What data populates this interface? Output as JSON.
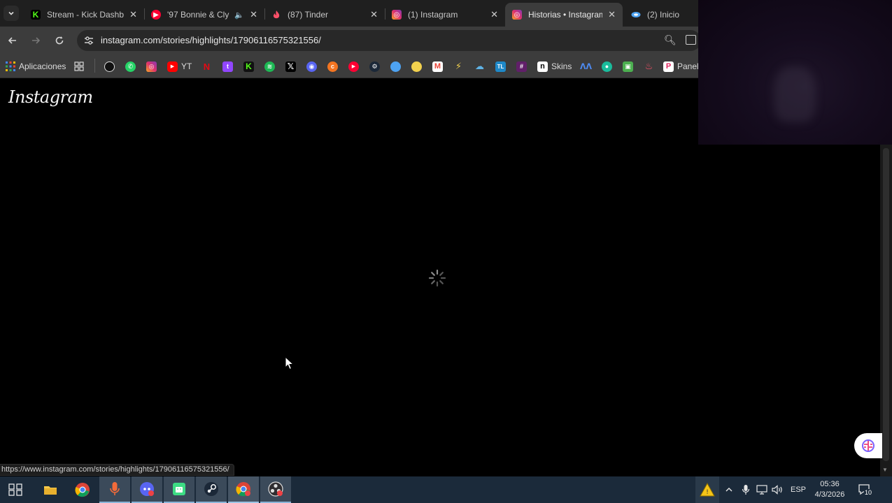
{
  "browser": {
    "tabs": [
      {
        "title": "Stream - Kick Dashbo",
        "active": false,
        "favicon": "kick-icon",
        "color": "#53fc18"
      },
      {
        "title": "'97 Bonnie & Cly",
        "active": false,
        "favicon": "youtube-music-icon",
        "color": "#ff0033",
        "muted": true
      },
      {
        "title": "(87) Tinder",
        "active": false,
        "favicon": "tinder-icon",
        "color": "#fd5068"
      },
      {
        "title": "(1) Instagram",
        "active": false,
        "favicon": "instagram-icon",
        "color": "#e1306c"
      },
      {
        "title": "Historias • Instagram",
        "active": true,
        "favicon": "instagram-icon",
        "color": "#e1306c"
      },
      {
        "title": "(2) Inicio",
        "active": false,
        "favicon": "site-icon",
        "color": "#4ea3f2"
      }
    ],
    "url": "instagram.com/stories/highlights/17906116575321556/",
    "bookmarks": {
      "apps_label": "Aplicaciones",
      "yt_label": "YT",
      "skins_label": "Skins",
      "panel_label": "Panel"
    },
    "status_url": "https://www.instagram.com/stories/highlights/17906116575321556/"
  },
  "page": {
    "logo": "Instagram",
    "state": "loading"
  },
  "taskbar": {
    "language": "ESP",
    "time": "05:36",
    "date": "4/3/2026",
    "notification_count": "10"
  }
}
